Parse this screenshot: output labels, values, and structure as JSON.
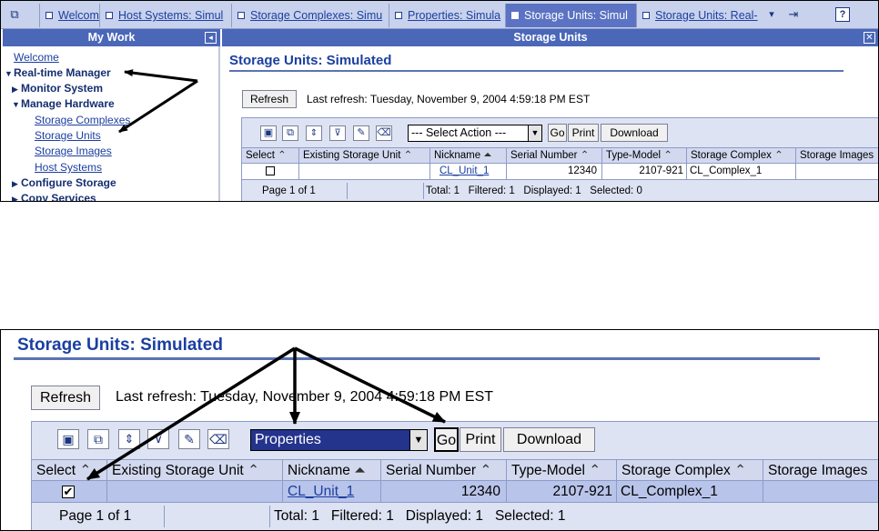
{
  "top": {
    "tabs": [
      {
        "label": "Welcom",
        "active": false
      },
      {
        "label": "Host Systems: Simul",
        "active": false
      },
      {
        "label": "Storage Complexes: Simu",
        "active": false
      },
      {
        "label": "Properties: Simula",
        "active": false
      },
      {
        "label": "Storage Units: Simul",
        "active": true
      },
      {
        "label": "Storage Units: Real-",
        "active": false
      }
    ],
    "mywork_title": "My Work",
    "nav": {
      "welcome": "Welcome",
      "realtime_manager": "Real-time Manager",
      "monitor_system": "Monitor System",
      "manage_hardware": "Manage Hardware",
      "storage_complexes": "Storage Complexes",
      "storage_units": "Storage Units",
      "storage_images": "Storage Images",
      "host_systems": "Host Systems",
      "configure_storage": "Configure Storage",
      "copy_services": "Copy Services"
    },
    "pane_title": "Storage Units",
    "page_title": "Storage Units: Simulated",
    "refresh_label": "Refresh",
    "last_refresh": "Last refresh: Tuesday, November 9, 2004 4:59:18 PM EST",
    "action_select": "--- Select Action ---",
    "go": "Go",
    "print": "Print",
    "download": "Download",
    "columns": [
      "Select",
      "Existing Storage Unit",
      "Nickname",
      "Serial Number",
      "Type-Model",
      "Storage Complex",
      "Storage Images"
    ],
    "row": {
      "nickname": "CL_Unit_1",
      "serial": "12340",
      "type_model": "2107-921",
      "complex": "CL_Complex_1"
    },
    "footer": {
      "page": "Page 1 of 1",
      "total": "Total: 1",
      "filtered": "Filtered: 1",
      "displayed": "Displayed: 1",
      "selected": "Selected: 0"
    }
  },
  "bottom": {
    "page_title": "Storage Units: Simulated",
    "refresh_label": "Refresh",
    "last_refresh": "Last refresh: Tuesday, November 9, 2004 4:59:18 PM EST",
    "action_select": "Properties",
    "go": "Go",
    "print": "Print",
    "download": "Download",
    "columns": [
      "Select",
      "Existing Storage Unit",
      "Nickname",
      "Serial Number",
      "Type-Model",
      "Storage Complex",
      "Storage Images"
    ],
    "row": {
      "checked": true,
      "nickname": "CL_Unit_1",
      "serial": "12340",
      "type_model": "2107-921",
      "complex": "CL_Complex_1"
    },
    "footer": {
      "page": "Page 1 of 1",
      "total": "Total: 1",
      "filtered": "Filtered: 1",
      "displayed": "Displayed: 1",
      "selected": "Selected: 1"
    }
  },
  "colors": {
    "accent": "#4a67b8",
    "link": "#1b3fa1",
    "panel": "#dde3f3",
    "selected_row": "#b9c4ea"
  },
  "icons": [
    "window-icon",
    "checkbox-icon",
    "logout-icon",
    "help-icon",
    "collapse-icon",
    "close-icon",
    "select-all-icon",
    "deselect-all-icon",
    "expand-icon",
    "collapse-rows-icon",
    "filter-icon",
    "edit-sort-icon",
    "clear-sort-icon",
    "dropdown-arrow-icon",
    "sort-ascending-icon",
    "sort-icon"
  ]
}
